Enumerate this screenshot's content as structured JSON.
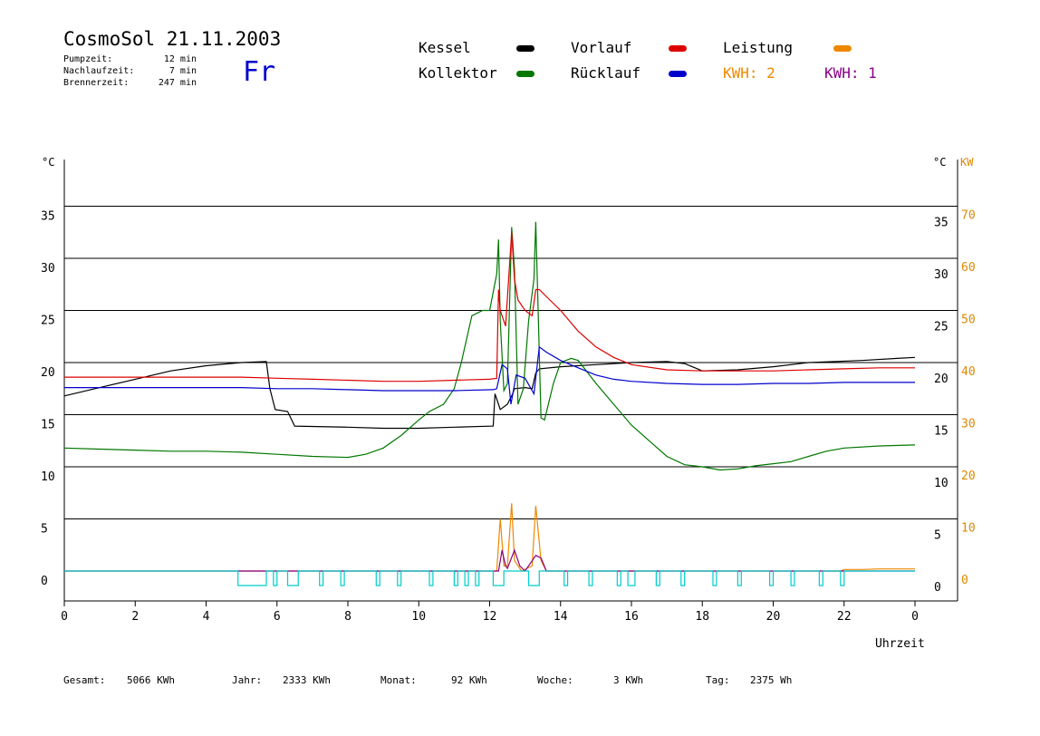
{
  "header": {
    "title": "CosmoSol 21.11.2003",
    "weekday": "Fr",
    "stats": [
      {
        "label": "Pumpzeit:",
        "value": "12 min"
      },
      {
        "label": "Nachlaufzeit:",
        "value": "7 min"
      },
      {
        "label": "Brennerzeit:",
        "value": "247 min"
      }
    ]
  },
  "legend": {
    "kessel": {
      "label": "Kessel",
      "color": "#000000"
    },
    "kollektor": {
      "label": "Kollektor",
      "color": "#007700"
    },
    "vorlauf": {
      "label": "Vorlauf",
      "color": "#dd0000"
    },
    "ruecklauf": {
      "label": "Rücklauf",
      "color": "#0000cc"
    },
    "leistung": {
      "label": "Leistung",
      "color": "#ee8800"
    },
    "kwh2": {
      "label": "KWH: 2",
      "color": "#ee8800"
    },
    "kwh1": {
      "label": "KWH: 1",
      "color": "#880088"
    }
  },
  "footer": [
    {
      "label": "Gesamt:",
      "value": "5066 KWh"
    },
    {
      "label": "Jahr:",
      "value": "2333 KWh"
    },
    {
      "label": "Monat:",
      "value": "92 KWh"
    },
    {
      "label": "Woche:",
      "value": "3 KWh"
    },
    {
      "label": "Tag:",
      "value": "2375 Wh"
    }
  ],
  "chart_data": {
    "type": "line",
    "xlabel": "Uhrzeit",
    "y_unit_left": "°C",
    "y_unit_right": [
      "°C",
      "KW"
    ],
    "xlim": [
      0,
      24
    ],
    "ylim": [
      -2.8,
      39.5
    ],
    "x_ticks": [
      0,
      2,
      4,
      6,
      8,
      10,
      12,
      14,
      16,
      18,
      20,
      22,
      24
    ],
    "x_tick_labels": [
      "0",
      "2",
      "4",
      "6",
      "8",
      "10",
      "12",
      "14",
      "16",
      "18",
      "20",
      "22",
      "0"
    ],
    "y_ticks": [
      0,
      5,
      10,
      15,
      20,
      25,
      30,
      35
    ],
    "y_right_kw_ticks": [
      0,
      10,
      20,
      30,
      40,
      50,
      60,
      70
    ],
    "grid": true,
    "series": [
      {
        "name": "Kessel",
        "color": "#000000",
        "points": [
          [
            0,
            16.8
          ],
          [
            1,
            17.6
          ],
          [
            2,
            18.4
          ],
          [
            3,
            19.2
          ],
          [
            4,
            19.7
          ],
          [
            5,
            20
          ],
          [
            5.7,
            20.1
          ],
          [
            5.8,
            17.5
          ],
          [
            5.95,
            15.5
          ],
          [
            6.3,
            15.3
          ],
          [
            6.5,
            13.9
          ],
          [
            8,
            13.8
          ],
          [
            9,
            13.7
          ],
          [
            10,
            13.7
          ],
          [
            11,
            13.8
          ],
          [
            12.1,
            13.9
          ],
          [
            12.15,
            17
          ],
          [
            12.3,
            15.5
          ],
          [
            12.5,
            16
          ],
          [
            12.65,
            17
          ],
          [
            12.7,
            17.5
          ],
          [
            13.0,
            17.6
          ],
          [
            13.2,
            17.5
          ],
          [
            13.3,
            19
          ],
          [
            13.4,
            19.4
          ],
          [
            14,
            19.6
          ],
          [
            15,
            19.8
          ],
          [
            16,
            20
          ],
          [
            17,
            20.1
          ],
          [
            17.5,
            19.9
          ],
          [
            18,
            19.2
          ],
          [
            19,
            19.3
          ],
          [
            20,
            19.6
          ],
          [
            21,
            20
          ],
          [
            22.5,
            20.2
          ],
          [
            23.5,
            20.4
          ],
          [
            24,
            20.5
          ]
        ]
      },
      {
        "name": "Kollektor",
        "color": "#007700",
        "points": [
          [
            0,
            11.8
          ],
          [
            1,
            11.7
          ],
          [
            2,
            11.6
          ],
          [
            3,
            11.5
          ],
          [
            4,
            11.5
          ],
          [
            5,
            11.4
          ],
          [
            6,
            11.2
          ],
          [
            7,
            11
          ],
          [
            8,
            10.9
          ],
          [
            8.5,
            11.2
          ],
          [
            9,
            11.8
          ],
          [
            9.5,
            13
          ],
          [
            10,
            14.5
          ],
          [
            10.3,
            15.3
          ],
          [
            10.7,
            16
          ],
          [
            11,
            17.5
          ],
          [
            11.2,
            20
          ],
          [
            11.5,
            24.5
          ],
          [
            11.8,
            25
          ],
          [
            12,
            25
          ],
          [
            12.2,
            28.5
          ],
          [
            12.25,
            31.8
          ],
          [
            12.3,
            24
          ],
          [
            12.4,
            17.3
          ],
          [
            12.5,
            18
          ],
          [
            12.62,
            33
          ],
          [
            12.7,
            29
          ],
          [
            12.8,
            16
          ],
          [
            12.95,
            17.5
          ],
          [
            13.1,
            24
          ],
          [
            13.25,
            28
          ],
          [
            13.3,
            33.5
          ],
          [
            13.45,
            14.7
          ],
          [
            13.55,
            14.5
          ],
          [
            13.8,
            18
          ],
          [
            14,
            20
          ],
          [
            14.3,
            20.4
          ],
          [
            14.5,
            20.2
          ],
          [
            15,
            18
          ],
          [
            15.5,
            16
          ],
          [
            16,
            14
          ],
          [
            16.5,
            12.5
          ],
          [
            17,
            11
          ],
          [
            17.5,
            10.2
          ],
          [
            18,
            10
          ],
          [
            18.5,
            9.7
          ],
          [
            19,
            9.8
          ],
          [
            19.5,
            10.1
          ],
          [
            20,
            10.3
          ],
          [
            20.5,
            10.5
          ],
          [
            21,
            11
          ],
          [
            21.5,
            11.5
          ],
          [
            22,
            11.8
          ],
          [
            23,
            12
          ],
          [
            24,
            12.1
          ]
        ]
      },
      {
        "name": "Vorlauf",
        "color": "#dd0000",
        "points": [
          [
            0,
            18.6
          ],
          [
            2,
            18.6
          ],
          [
            4,
            18.6
          ],
          [
            5,
            18.6
          ],
          [
            6,
            18.5
          ],
          [
            7,
            18.4
          ],
          [
            8,
            18.3
          ],
          [
            9,
            18.2
          ],
          [
            10,
            18.2
          ],
          [
            11,
            18.3
          ],
          [
            12,
            18.4
          ],
          [
            12.2,
            18.5
          ],
          [
            12.25,
            27
          ],
          [
            12.3,
            25
          ],
          [
            12.45,
            23.5
          ],
          [
            12.62,
            32.5
          ],
          [
            12.7,
            28
          ],
          [
            12.8,
            26
          ],
          [
            13,
            25
          ],
          [
            13.2,
            24.5
          ],
          [
            13.3,
            27
          ],
          [
            13.4,
            27
          ],
          [
            13.7,
            26
          ],
          [
            14,
            25
          ],
          [
            14.5,
            23
          ],
          [
            15,
            21.5
          ],
          [
            15.5,
            20.5
          ],
          [
            16,
            19.8
          ],
          [
            17,
            19.3
          ],
          [
            18,
            19.2
          ],
          [
            19,
            19.2
          ],
          [
            20,
            19.2
          ],
          [
            21,
            19.3
          ],
          [
            22,
            19.4
          ],
          [
            23,
            19.5
          ],
          [
            24,
            19.5
          ]
        ]
      },
      {
        "name": "Rücklauf",
        "color": "#0000cc",
        "points": [
          [
            0,
            17.6
          ],
          [
            2,
            17.6
          ],
          [
            4,
            17.6
          ],
          [
            5,
            17.6
          ],
          [
            6,
            17.5
          ],
          [
            7,
            17.5
          ],
          [
            8,
            17.4
          ],
          [
            9,
            17.3
          ],
          [
            10,
            17.3
          ],
          [
            11,
            17.3
          ],
          [
            12.1,
            17.4
          ],
          [
            12.2,
            17.5
          ],
          [
            12.35,
            19.8
          ],
          [
            12.5,
            19.4
          ],
          [
            12.6,
            16
          ],
          [
            12.75,
            18.8
          ],
          [
            13,
            18.5
          ],
          [
            13.25,
            17
          ],
          [
            13.4,
            21.5
          ],
          [
            13.6,
            21
          ],
          [
            14,
            20.2
          ],
          [
            14.5,
            19.5
          ],
          [
            15,
            18.8
          ],
          [
            15.5,
            18.4
          ],
          [
            16,
            18.2
          ],
          [
            17,
            18
          ],
          [
            18,
            17.9
          ],
          [
            19,
            17.9
          ],
          [
            20,
            18
          ],
          [
            21,
            18
          ],
          [
            22,
            18.1
          ],
          [
            24,
            18.1
          ]
        ]
      },
      {
        "name": "Leistung",
        "color": "#ee8800",
        "unit": "KW",
        "points": [
          [
            0,
            0
          ],
          [
            12.2,
            0
          ],
          [
            12.3,
            10
          ],
          [
            12.4,
            1
          ],
          [
            12.5,
            1
          ],
          [
            12.62,
            13
          ],
          [
            12.7,
            2
          ],
          [
            12.9,
            0
          ],
          [
            13.2,
            1
          ],
          [
            13.3,
            12.5
          ],
          [
            13.45,
            2
          ],
          [
            13.6,
            0
          ],
          [
            21.9,
            0
          ],
          [
            22,
            0.3
          ],
          [
            22.5,
            0.3
          ],
          [
            23,
            0.4
          ],
          [
            24,
            0.4
          ]
        ]
      },
      {
        "name": "KWH: 1",
        "color": "#880088",
        "unit": "KW",
        "points": [
          [
            0,
            0
          ],
          [
            12.25,
            0
          ],
          [
            12.35,
            4
          ],
          [
            12.45,
            1
          ],
          [
            12.5,
            0.5
          ],
          [
            12.7,
            4
          ],
          [
            12.85,
            1
          ],
          [
            13.0,
            0
          ],
          [
            13.3,
            3
          ],
          [
            13.45,
            2.5
          ],
          [
            13.6,
            0
          ],
          [
            24,
            0
          ]
        ]
      },
      {
        "name": "Pumpe",
        "color": "#00cccc",
        "unit": "state",
        "on_intervals": [
          [
            4.9,
            5.7
          ],
          [
            5.9,
            6.0
          ],
          [
            6.3,
            6.6
          ],
          [
            7.2,
            7.3
          ],
          [
            7.8,
            7.9
          ],
          [
            8.8,
            8.9
          ],
          [
            9.4,
            9.5
          ],
          [
            10.3,
            10.4
          ],
          [
            11,
            11.1
          ],
          [
            11.3,
            11.4
          ],
          [
            11.6,
            11.7
          ],
          [
            12.1,
            12.4
          ],
          [
            13.1,
            13.4
          ],
          [
            14.1,
            14.2
          ],
          [
            14.8,
            14.9
          ],
          [
            15.6,
            15.7
          ],
          [
            15.9,
            16.1
          ],
          [
            16.7,
            16.8
          ],
          [
            17.4,
            17.5
          ],
          [
            18.3,
            18.4
          ],
          [
            19,
            19.1
          ],
          [
            19.9,
            20
          ],
          [
            20.5,
            20.6
          ],
          [
            21.3,
            21.4
          ],
          [
            21.9,
            22
          ]
        ]
      }
    ]
  }
}
